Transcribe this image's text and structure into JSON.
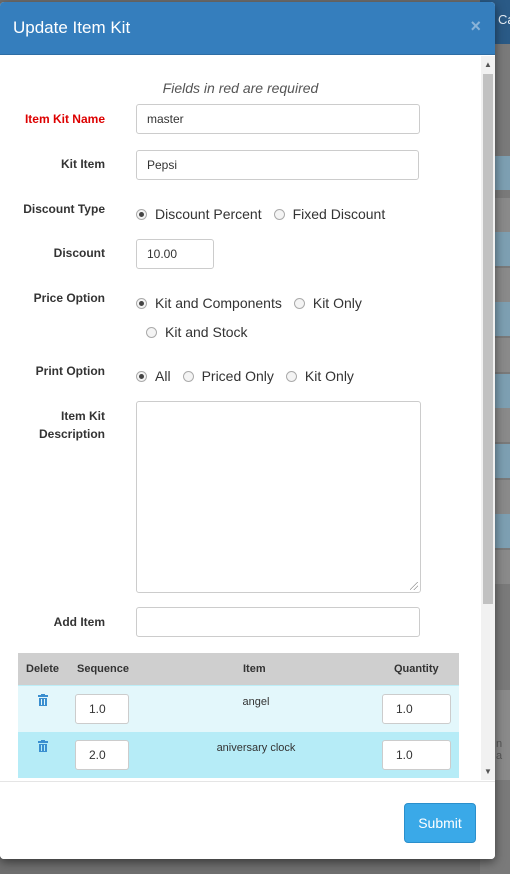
{
  "modal": {
    "title": "Update Item Kit",
    "close_symbol": "×",
    "required_note": "Fields in red are required"
  },
  "background": {
    "header_text": "Ca",
    "bottom_text": "n a"
  },
  "form": {
    "item_kit_name": {
      "label": "Item Kit Name",
      "value": "master"
    },
    "kit_item": {
      "label": "Kit Item",
      "value": "Pepsi"
    },
    "discount_type": {
      "label": "Discount Type",
      "options": [
        "Discount Percent",
        "Fixed Discount"
      ],
      "selected": "Discount Percent"
    },
    "discount": {
      "label": "Discount",
      "value": "10.00"
    },
    "price_option": {
      "label": "Price Option",
      "options": [
        "Kit and Components",
        "Kit Only",
        "Kit and Stock"
      ],
      "selected": "Kit and Components"
    },
    "print_option": {
      "label": "Print Option",
      "options": [
        "All",
        "Priced Only",
        "Kit Only"
      ],
      "selected": "All"
    },
    "description": {
      "label_line1": "Item Kit",
      "label_line2": "Description",
      "value": ""
    },
    "add_item": {
      "label": "Add Item",
      "value": ""
    }
  },
  "table": {
    "headers": [
      "Delete",
      "Sequence",
      "Item",
      "Quantity"
    ],
    "rows": [
      {
        "sequence": "1.0",
        "item": "angel",
        "quantity": "1.0"
      },
      {
        "sequence": "2.0",
        "item": "aniversary clock",
        "quantity": "1.0"
      }
    ]
  },
  "footer": {
    "submit_label": "Submit"
  },
  "icons": {
    "close": "close-icon",
    "delete": "trash-icon"
  },
  "colors": {
    "header": "#357ebd",
    "required": "#dd0000",
    "submit": "#3aa9e8",
    "row_selected": "#b6ecf7"
  }
}
